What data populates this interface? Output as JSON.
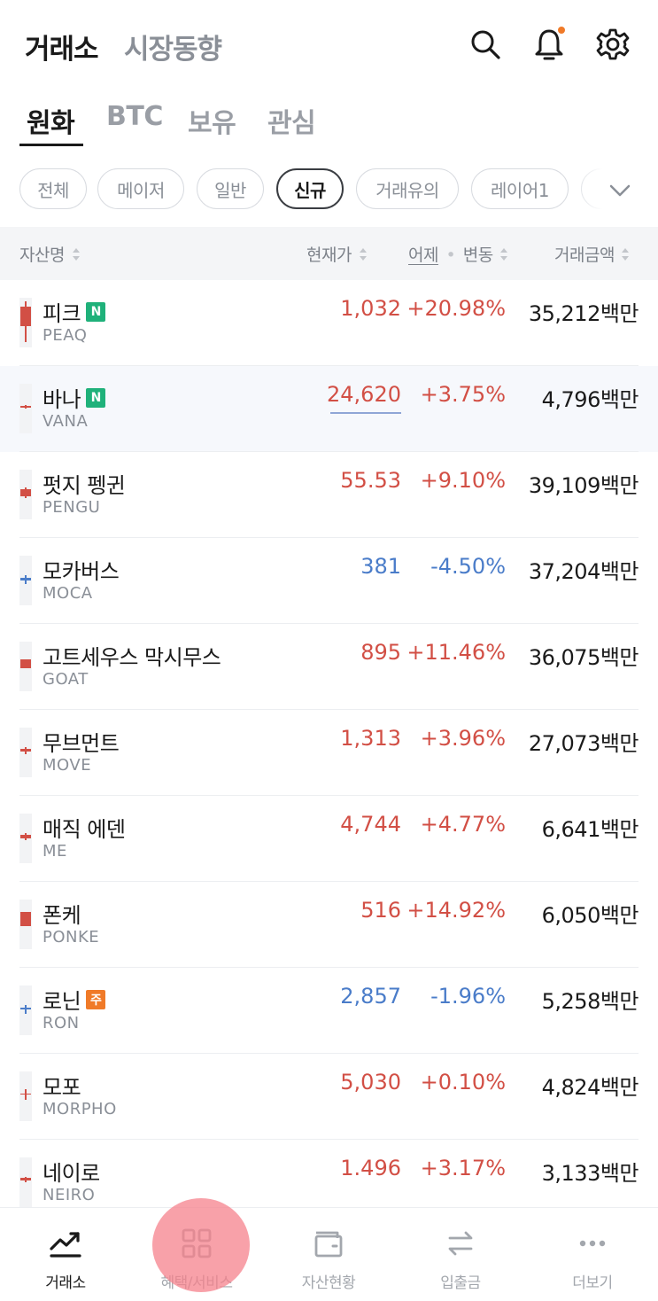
{
  "header": {
    "title_active": "거래소",
    "title_inactive": "시장동향",
    "icons": [
      "search-icon",
      "bell-icon",
      "gear-icon"
    ],
    "notification_dot_color": "#f07a28"
  },
  "tabs": [
    "원화",
    "BTC",
    "보유",
    "관심"
  ],
  "active_tab": "원화",
  "chips": [
    "전체",
    "메이저",
    "일반",
    "신규",
    "거래유의",
    "레이어1"
  ],
  "active_chip": "신규",
  "columns": {
    "name": "자산명",
    "price": "현재가",
    "change_prefix": "어제",
    "change_sep": "•",
    "change": "변동",
    "volume": "거래금액"
  },
  "assets": [
    {
      "name": "피크",
      "symbol": "PEAQ",
      "badge": "N",
      "price": "1,032",
      "change": "+20.98%",
      "volume": "35,212백만",
      "trend": "up"
    },
    {
      "name": "바나",
      "symbol": "VANA",
      "badge": "N",
      "price": "24,620",
      "change": "+3.75%",
      "volume": "4,796백만",
      "trend": "up"
    },
    {
      "name": "펏지 펭귄",
      "symbol": "PENGU",
      "badge": "",
      "price": "55.53",
      "change": "+9.10%",
      "volume": "39,109백만",
      "trend": "up"
    },
    {
      "name": "모카버스",
      "symbol": "MOCA",
      "badge": "",
      "price": "381",
      "change": "-4.50%",
      "volume": "37,204백만",
      "trend": "down"
    },
    {
      "name": "고트세우스 막시무스",
      "symbol": "GOAT",
      "badge": "",
      "price": "895",
      "change": "+11.46%",
      "volume": "36,075백만",
      "trend": "up"
    },
    {
      "name": "무브먼트",
      "symbol": "MOVE",
      "badge": "",
      "price": "1,313",
      "change": "+3.96%",
      "volume": "27,073백만",
      "trend": "up"
    },
    {
      "name": "매직 에덴",
      "symbol": "ME",
      "badge": "",
      "price": "4,744",
      "change": "+4.77%",
      "volume": "6,641백만",
      "trend": "up"
    },
    {
      "name": "폰케",
      "symbol": "PONKE",
      "badge": "",
      "price": "516",
      "change": "+14.92%",
      "volume": "6,050백만",
      "trend": "up"
    },
    {
      "name": "로닌",
      "symbol": "RON",
      "badge": "주",
      "price": "2,857",
      "change": "-1.96%",
      "volume": "5,258백만",
      "trend": "down"
    },
    {
      "name": "모포",
      "symbol": "MORPHO",
      "badge": "",
      "price": "5,030",
      "change": "+0.10%",
      "volume": "4,824백만",
      "trend": "up"
    },
    {
      "name": "네이로",
      "symbol": "NEIRO",
      "badge": "",
      "price": "1.496",
      "change": "+3.17%",
      "volume": "3,133백만",
      "trend": "up"
    }
  ],
  "bottom_nav": [
    {
      "label": "거래소",
      "icon": "chart-trend-icon"
    },
    {
      "label": "혜택/서비스",
      "icon": "grid-icon"
    },
    {
      "label": "자산현황",
      "icon": "wallet-icon"
    },
    {
      "label": "입출금",
      "icon": "transfer-arrows-icon"
    },
    {
      "label": "더보기",
      "icon": "more-dots-icon"
    }
  ],
  "colors": {
    "up": "#d24f45",
    "down": "#4a7cc9",
    "new_badge": "#1fb17a",
    "warn_badge": "#f07a28"
  }
}
